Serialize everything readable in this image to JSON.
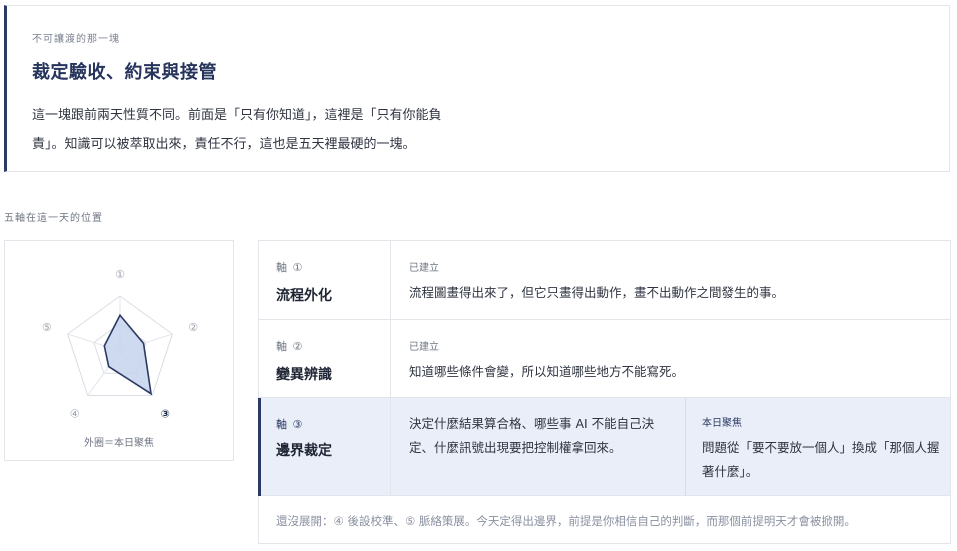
{
  "intro": {
    "kicker": "不可讓渡的那一塊",
    "title": "裁定驗收、約束與接管",
    "body_line1": "這一塊跟前兩天性質不同。前面是「只有你知道」，這裡是「只有你能負",
    "body_line2": "責」。知識可以被萃取出來，責任不行，這也是五天裡最硬的一塊。"
  },
  "section_label": "五軸在這一天的位置",
  "radar": {
    "labels": [
      "①",
      "②",
      "③",
      "④",
      "⑤"
    ],
    "highlight_index": 2,
    "values": [
      0.65,
      0.45,
      0.96,
      0.35,
      0.3
    ],
    "caption": "外圈＝本日聚焦",
    "fill_color": "#c6d3ec",
    "stroke_color": "#2b3a63"
  },
  "axes": [
    {
      "num": "軸 ①",
      "name": "流程外化",
      "status": "已建立",
      "desc": "流程圖畫得出來了，但它只畫得出動作，畫不出動作之間發生的事。"
    },
    {
      "num": "軸 ②",
      "name": "變異辨識",
      "status": "已建立",
      "desc": "知道哪些條件會變，所以知道哪些地方不能寫死。"
    },
    {
      "num": "軸 ③",
      "name": "邊界裁定",
      "desc": "決定什麼結果算合格、哪些事 AI 不能自己決定、什麼訊號出現要把控制權拿回來。",
      "focus_label": "本日聚焦",
      "focus_text": "問題從「要不要放一個人」換成「那個人握著什麼」。"
    }
  ],
  "footer_note": "還沒展開：④ 後設校準、⑤ 脈絡策展。今天定得出邊界，前提是你相信自己的判斷，而那個前提明天才會被掀開。"
}
